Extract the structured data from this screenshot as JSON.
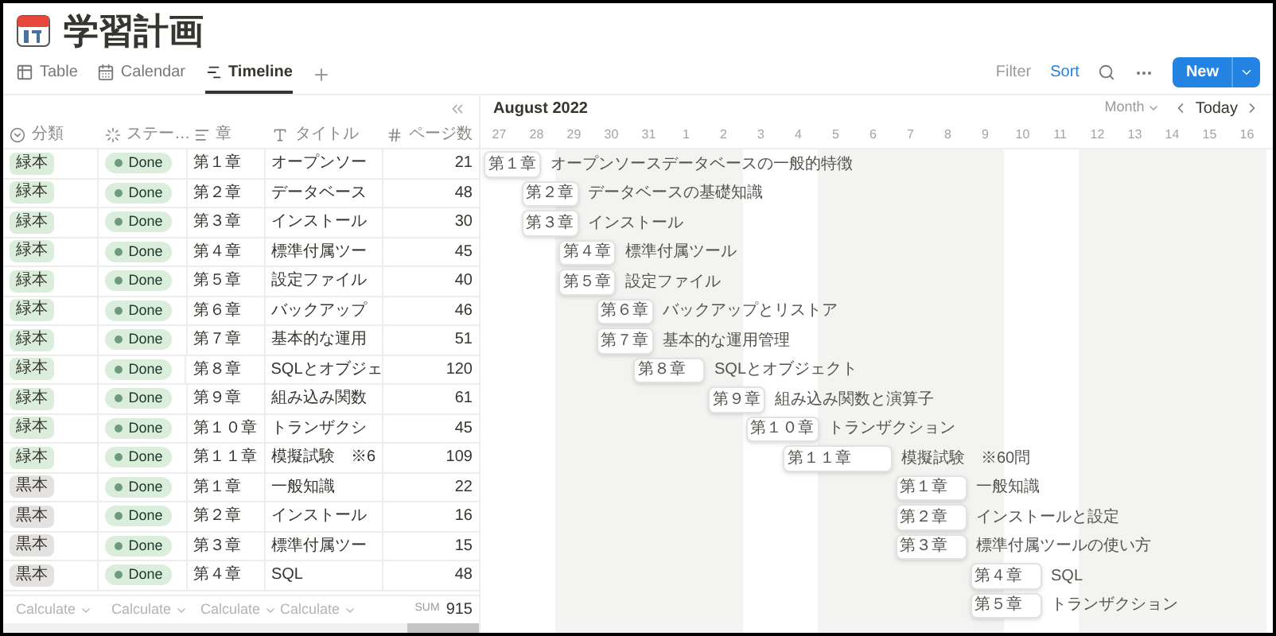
{
  "page": {
    "title": "学習計画"
  },
  "views": [
    {
      "label": "Table",
      "kind": "table",
      "selected": false
    },
    {
      "label": "Calendar",
      "kind": "calendar",
      "selected": false
    },
    {
      "label": "Timeline",
      "kind": "timeline",
      "selected": true
    }
  ],
  "toolbar": {
    "filter": "Filter",
    "sort": "Sort",
    "new_button": "New"
  },
  "table": {
    "columns": [
      {
        "label": "分類",
        "kind": "select"
      },
      {
        "label": "ステー…",
        "kind": "status"
      },
      {
        "label": "章",
        "kind": "text"
      },
      {
        "label": "タイトル",
        "kind": "title"
      },
      {
        "label": "ページ数",
        "kind": "number"
      }
    ],
    "rows": [
      {
        "category": "緑本",
        "color": "#dbeddb",
        "status": "Done",
        "chapter": "第１章",
        "title": "オープンソー",
        "pages": "21"
      },
      {
        "category": "緑本",
        "color": "#dbeddb",
        "status": "Done",
        "chapter": "第２章",
        "title": "データベース",
        "pages": "48"
      },
      {
        "category": "緑本",
        "color": "#dbeddb",
        "status": "Done",
        "chapter": "第３章",
        "title": "インストール",
        "pages": "30"
      },
      {
        "category": "緑本",
        "color": "#dbeddb",
        "status": "Done",
        "chapter": "第４章",
        "title": "標準付属ツー",
        "pages": "45"
      },
      {
        "category": "緑本",
        "color": "#dbeddb",
        "status": "Done",
        "chapter": "第５章",
        "title": "設定ファイル",
        "pages": "40"
      },
      {
        "category": "緑本",
        "color": "#dbeddb",
        "status": "Done",
        "chapter": "第６章",
        "title": "バックアップ",
        "pages": "46"
      },
      {
        "category": "緑本",
        "color": "#dbeddb",
        "status": "Done",
        "chapter": "第７章",
        "title": "基本的な運用",
        "pages": "51"
      },
      {
        "category": "緑本",
        "color": "#dbeddb",
        "status": "Done",
        "chapter": "第８章",
        "title": "SQLとオブジェ",
        "pages": "120"
      },
      {
        "category": "緑本",
        "color": "#dbeddb",
        "status": "Done",
        "chapter": "第９章",
        "title": "組み込み関数",
        "pages": "61"
      },
      {
        "category": "緑本",
        "color": "#dbeddb",
        "status": "Done",
        "chapter": "第１０章",
        "title": "トランザクシ",
        "pages": "45"
      },
      {
        "category": "緑本",
        "color": "#dbeddb",
        "status": "Done",
        "chapter": "第１１章",
        "title": "模擬試験　※6",
        "pages": "109"
      },
      {
        "category": "黒本",
        "color": "#e3e2e0",
        "status": "Done",
        "chapter": "第１章",
        "title": "一般知識",
        "pages": "22"
      },
      {
        "category": "黒本",
        "color": "#e3e2e0",
        "status": "Done",
        "chapter": "第２章",
        "title": "インストール",
        "pages": "16"
      },
      {
        "category": "黒本",
        "color": "#e3e2e0",
        "status": "Done",
        "chapter": "第３章",
        "title": "標準付属ツー",
        "pages": "15"
      },
      {
        "category": "黒本",
        "color": "#e3e2e0",
        "status": "Done",
        "chapter": "第４章",
        "title": "SQL",
        "pages": "48"
      }
    ],
    "footer": {
      "calculate": [
        "Calculate",
        "Calculate",
        "Calculate",
        "Calculate"
      ],
      "sum_label": "SUM",
      "sum_value": "915"
    }
  },
  "timeline": {
    "month": "August 2022",
    "scale": "Month",
    "today": "Today",
    "days": [
      {
        "label": "27",
        "shaded": false,
        "bars": [
          {
            "chapter": "第１章",
            "title": "オープンソースデータベースの一般的特徴",
            "kind": "single"
          }
        ]
      },
      {
        "label": "28",
        "shaded": false,
        "bars": [
          {
            "chapter": "第２章",
            "title": "データベースの基礎知識",
            "kind": "single"
          },
          {
            "chapter": "第３章",
            "title": "インストール",
            "kind": "single"
          }
        ]
      },
      {
        "label": "29",
        "shaded": true,
        "bars": [
          {
            "chapter": "第４章",
            "title": "標準付属ツール",
            "kind": "single"
          },
          {
            "chapter": "第５章",
            "title": "設定ファイル",
            "kind": "single"
          }
        ]
      },
      {
        "label": "30",
        "shaded": true,
        "bars": [
          {
            "chapter": "第６章",
            "title": "バックアップとリストア",
            "kind": "single"
          },
          {
            "chapter": "第７章",
            "title": "基本的な運用管理",
            "kind": "single"
          }
        ]
      },
      {
        "label": "31",
        "shaded": true,
        "bars": [
          {
            "chapter": "第８章",
            "title": "SQLとオブジェクト",
            "kind": "double"
          }
        ]
      },
      {
        "label": "1",
        "shaded": true
      },
      {
        "label": "2",
        "shaded": true,
        "bars": [
          {
            "chapter": "第９章",
            "title": "組み込み関数と演算子",
            "kind": "single"
          }
        ]
      },
      {
        "label": "3",
        "shaded": false,
        "bars": [
          {
            "chapter": "第１０章",
            "title": "トランザクション",
            "kind": "single"
          }
        ]
      },
      {
        "label": "4",
        "shaded": false,
        "bars": [
          {
            "chapter": "第１１章",
            "title": "模擬試験　※60問",
            "kind": "triple"
          }
        ]
      },
      {
        "label": "5",
        "shaded": true
      },
      {
        "label": "6",
        "shaded": true
      },
      {
        "label": "7",
        "shaded": true,
        "bars": [
          {
            "chapter": "第１章",
            "title": "一般知識",
            "kind": "double"
          },
          {
            "chapter": "第２章",
            "title": "インストールと設定",
            "kind": "double"
          },
          {
            "chapter": "第３章",
            "title": "標準付属ツールの使い方",
            "kind": "double"
          }
        ]
      },
      {
        "label": "8",
        "shaded": true
      },
      {
        "label": "9",
        "shaded": true,
        "bars": [
          {
            "chapter": "第４章",
            "title": "SQL",
            "kind": "double"
          },
          {
            "chapter": "第５章",
            "title": "トランザクション",
            "kind": "double"
          }
        ]
      },
      {
        "label": "10",
        "shaded": false
      },
      {
        "label": "11",
        "shaded": false
      },
      {
        "label": "12",
        "shaded": true
      },
      {
        "label": "13",
        "shaded": true
      },
      {
        "label": "14",
        "shaded": true
      },
      {
        "label": "15",
        "shaded": true
      },
      {
        "label": "16",
        "shaded": true
      }
    ]
  }
}
